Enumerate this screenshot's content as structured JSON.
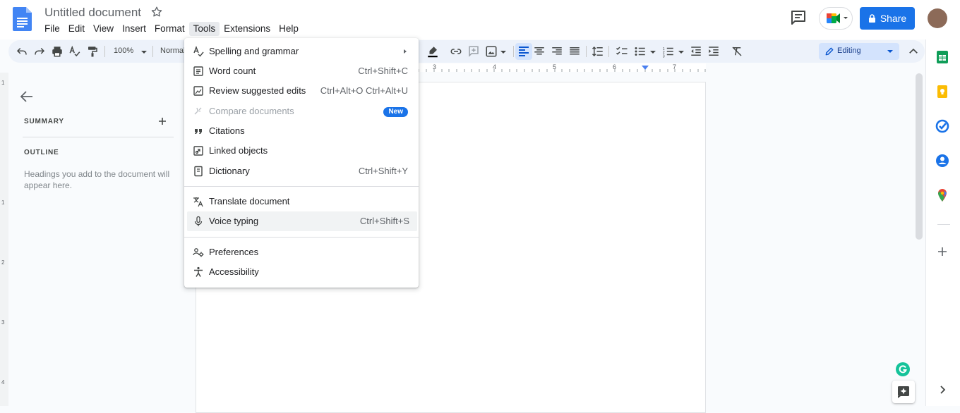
{
  "app": {
    "doc_title": "Untitled document",
    "menu": [
      "File",
      "Edit",
      "View",
      "Insert",
      "Format",
      "Tools",
      "Extensions",
      "Help"
    ],
    "share_label": "Share"
  },
  "toolbar": {
    "zoom": "100%",
    "style": "Normal",
    "mode": "Editing"
  },
  "ruler": {
    "numbers": [
      "3",
      "4",
      "5",
      "6",
      "7"
    ],
    "v_numbers": [
      "1",
      "1",
      "2",
      "3",
      "4"
    ]
  },
  "outline_panel": {
    "summary_label": "SUMMARY",
    "outline_label": "OUTLINE",
    "hint": "Headings you add to the document will appear here."
  },
  "tools_menu": {
    "items": [
      {
        "label": "Spelling and grammar",
        "shortcut": "",
        "icon": "spellcheck-icon"
      },
      {
        "label": "Word count",
        "shortcut": "Ctrl+Shift+C",
        "icon": "word-count-icon"
      },
      {
        "label": "Review suggested edits",
        "shortcut": "Ctrl+Alt+O Ctrl+Alt+U",
        "icon": "review-edits-icon"
      },
      {
        "label": "Compare documents",
        "shortcut": "",
        "icon": "compare-icon",
        "badge": "New"
      },
      {
        "label": "Citations",
        "shortcut": "",
        "icon": "quote-icon"
      },
      {
        "label": "Linked objects",
        "shortcut": "",
        "icon": "linked-objects-icon"
      },
      {
        "label": "Dictionary",
        "shortcut": "Ctrl+Shift+Y",
        "icon": "dictionary-icon"
      },
      {
        "label": "Translate document",
        "shortcut": "",
        "icon": "translate-icon"
      },
      {
        "label": "Voice typing",
        "shortcut": "Ctrl+Shift+S",
        "icon": "mic-icon"
      },
      {
        "label": "Preferences",
        "shortcut": "",
        "icon": "preferences-icon"
      },
      {
        "label": "Accessibility",
        "shortcut": "",
        "icon": "accessibility-icon"
      }
    ]
  },
  "colors": {
    "accent": "#1a73e8",
    "toolbar_bg": "#edf2fa",
    "editing_bg": "#d3e3fd"
  }
}
